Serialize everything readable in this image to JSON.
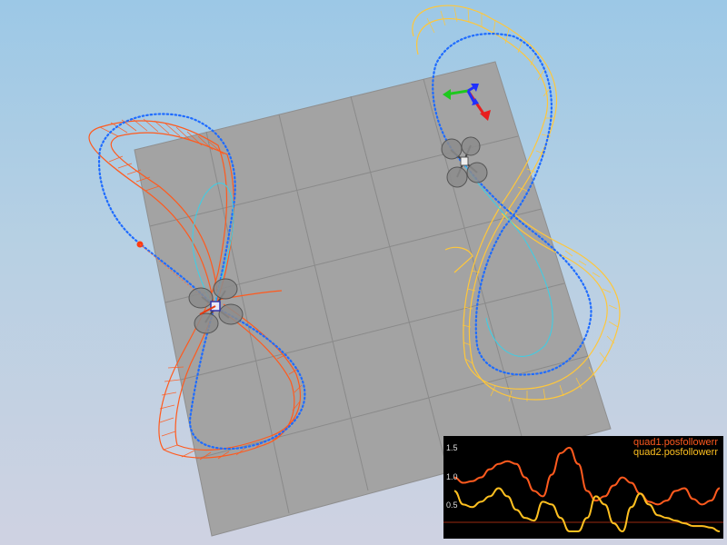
{
  "scene": {
    "sky_top": "#9cc8e6",
    "sky_bottom": "#cfd2e2",
    "floor_color": "#a3a3a3",
    "floor_grid_color": "#8a8a8a",
    "trajectory1_color": "#ff5a1e",
    "trajectory2_color": "#ffc73a",
    "path_dots_color": "#1f6cff",
    "axes_icons": [
      "x-axis-arrow-red",
      "y-axis-arrow-green",
      "z-axis-arrow-blue"
    ]
  },
  "plot": {
    "legend": [
      {
        "label": "quad1.posfollowerr",
        "color": "#ff5a1e"
      },
      {
        "label": "quad2.posfollowerr",
        "color": "#ffc020"
      }
    ],
    "y_ticks": [
      "1.5",
      "1.0",
      "0.5"
    ],
    "reference_line_color": "#9a2a10"
  },
  "chart_data": {
    "type": "line",
    "title": "",
    "xlabel": "",
    "ylabel": "",
    "ylim": [
      0,
      1.75
    ],
    "x": [
      0,
      1,
      2,
      3,
      4,
      5,
      6,
      7,
      8,
      9,
      10,
      11,
      12,
      13,
      14,
      15,
      16,
      17,
      18,
      19,
      20,
      21,
      22,
      23,
      24,
      25,
      26,
      27,
      28,
      29,
      30
    ],
    "series": [
      {
        "name": "quad1.posfollowerr",
        "values": [
          1.05,
          0.95,
          0.98,
          1.05,
          1.2,
          1.3,
          1.35,
          1.3,
          1.05,
          0.8,
          0.7,
          1.1,
          1.5,
          1.6,
          1.3,
          0.8,
          0.62,
          0.7,
          0.9,
          1.05,
          0.95,
          0.75,
          0.6,
          0.55,
          0.62,
          0.8,
          0.85,
          0.65,
          0.55,
          0.62,
          0.85
        ]
      },
      {
        "name": "quad2.posfollowerr",
        "values": [
          0.8,
          0.55,
          0.5,
          0.6,
          0.7,
          0.85,
          0.7,
          0.45,
          0.3,
          0.25,
          0.6,
          0.55,
          0.3,
          0.05,
          0.05,
          0.3,
          0.7,
          0.55,
          0.2,
          0.05,
          0.5,
          0.75,
          0.55,
          0.35,
          0.3,
          0.25,
          0.2,
          0.15,
          0.15,
          0.12,
          0.05
        ]
      }
    ]
  }
}
